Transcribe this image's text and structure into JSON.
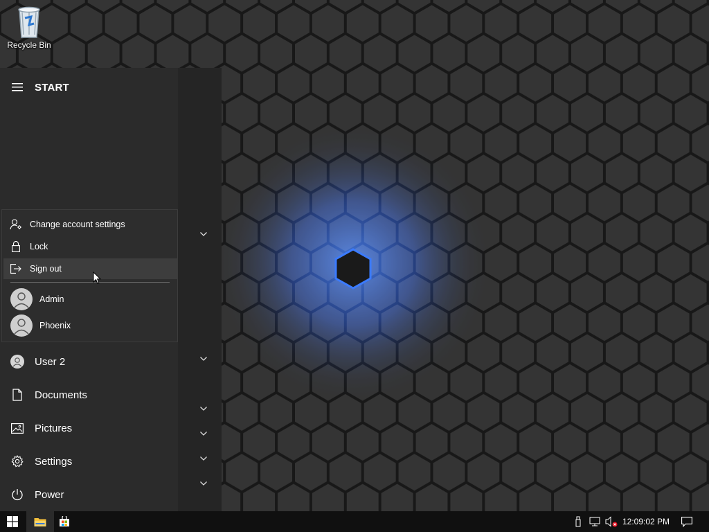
{
  "desktop": {
    "icons": [
      {
        "label": "Recycle Bin",
        "icon": "recycle-bin-icon"
      }
    ]
  },
  "start_menu": {
    "title": "START",
    "account_flyout": {
      "actions": [
        {
          "label": "Change account settings",
          "icon": "account-settings-icon"
        },
        {
          "label": "Lock",
          "icon": "lock-icon"
        },
        {
          "label": "Sign out",
          "icon": "sign-out-icon",
          "hovered": true
        }
      ],
      "users": [
        {
          "name": "Admin",
          "icon": "user-avatar-icon"
        },
        {
          "name": "Phoenix",
          "icon": "user-avatar-icon"
        }
      ]
    },
    "nav_items": [
      {
        "label": "User 2",
        "icon": "user-avatar-icon"
      },
      {
        "label": "Documents",
        "icon": "document-icon"
      },
      {
        "label": "Pictures",
        "icon": "pictures-icon"
      },
      {
        "label": "Settings",
        "icon": "gear-icon"
      },
      {
        "label": "Power",
        "icon": "power-icon"
      }
    ]
  },
  "taskbar": {
    "pinned": [
      {
        "name": "Start",
        "icon": "windows-logo-icon"
      },
      {
        "name": "File Explorer",
        "icon": "folder-icon"
      },
      {
        "name": "Microsoft Store",
        "icon": "store-bag-icon"
      }
    ],
    "tray": {
      "icons": [
        "usb-drive-icon",
        "network-icon",
        "volume-muted-icon"
      ],
      "clock": "12:09:02 PM",
      "notification_icon": "action-center-icon"
    }
  },
  "colors": {
    "accent_glow": "#2f6cff",
    "start_menu_bg": "#2b2b2b",
    "taskbar_bg": "#101010",
    "hover_bg": "#3d3d3d"
  }
}
